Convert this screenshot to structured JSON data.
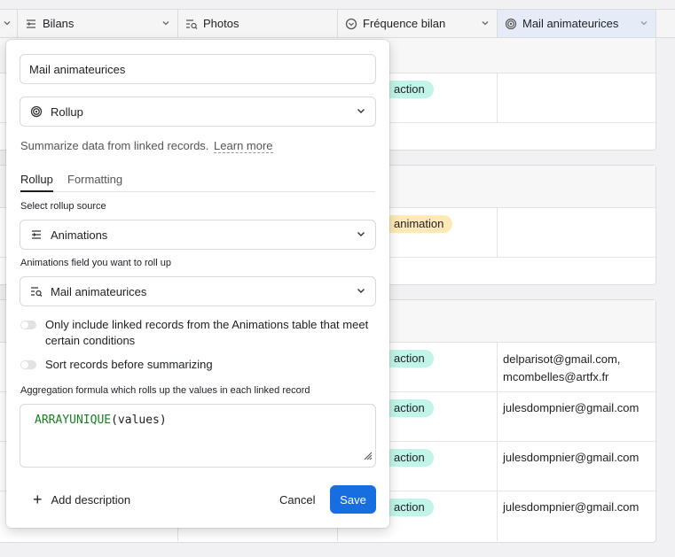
{
  "grid": {
    "columns": [
      {
        "label": "Bilans",
        "icon": "linked-record-icon"
      },
      {
        "label": "Photos",
        "icon": "lookup-icon"
      },
      {
        "label": "Fréquence bilan",
        "icon": "single-select-icon"
      },
      {
        "label": "Mail animateurices",
        "icon": "rollup-icon"
      }
    ],
    "group1": {
      "rows": [
        {
          "pill": "action",
          "mail": ""
        }
      ]
    },
    "group2": {
      "rows": [
        {
          "pill": "animation",
          "mail": ""
        }
      ]
    },
    "group3": {
      "rows": [
        {
          "pill": "action",
          "mail1": "delparisot@gmail.com,",
          "mail2": "mcombelles@artfx.fr"
        },
        {
          "pill": "action",
          "mail": "julesdompnier@gmail.com"
        },
        {
          "pill": "action",
          "mail": "julesdompnier@gmail.com"
        },
        {
          "pill": "action",
          "mail": "julesdompnier@gmail.com"
        }
      ]
    }
  },
  "popup": {
    "field_name": "Mail animateurices",
    "field_type": "Rollup",
    "helper_text": "Summarize data from linked records.",
    "helper_link": "Learn more",
    "tabs": [
      "Rollup",
      "Formatting"
    ],
    "source_label": "Select rollup source",
    "source_value": "Animations",
    "field_label": "Animations field you want to roll up",
    "field_value": "Mail animateurices",
    "toggle_conditions": "Only include linked records from the Animations table that meet certain conditions",
    "toggle_sort": "Sort records before summarizing",
    "aggregation_label": "Aggregation formula which rolls up the values in each linked record",
    "formula_fn": "ARRAYUNIQUE",
    "formula_args": "(values)",
    "add_description": "Add description",
    "cancel": "Cancel",
    "save": "Save"
  },
  "colors": {
    "accent": "#166ee1",
    "pill_teal": "#c2f5e9",
    "pill_orange": "#ffe9b6"
  }
}
